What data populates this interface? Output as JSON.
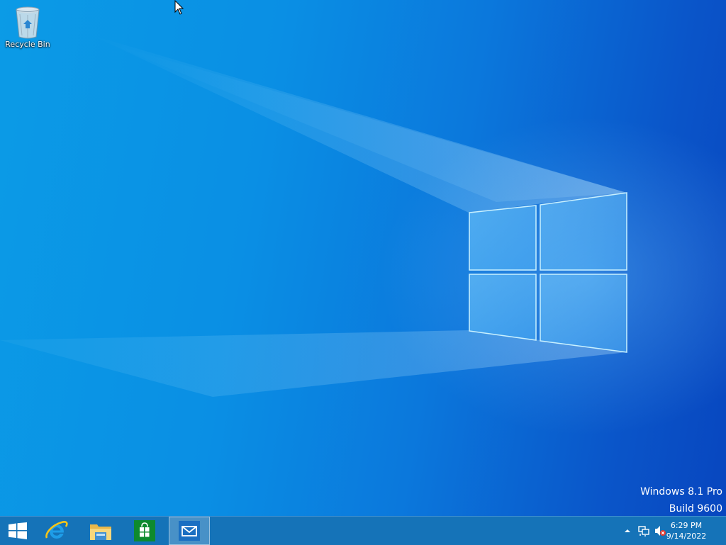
{
  "desktop": {
    "icons": [
      {
        "label": "Recycle Bin",
        "icon": "recycle-bin-icon"
      }
    ],
    "watermark": {
      "line1": "Windows 8.1 Pro",
      "line2": "Build 9600"
    }
  },
  "taskbar": {
    "start": {
      "icon": "windows-logo-icon"
    },
    "pinned": [
      {
        "name": "Internet Explorer",
        "icon": "internet-explorer-icon",
        "active": false
      },
      {
        "name": "File Explorer",
        "icon": "file-explorer-icon",
        "active": false
      },
      {
        "name": "Store",
        "icon": "store-icon",
        "active": false
      },
      {
        "name": "Mail",
        "icon": "mail-icon",
        "active": true
      }
    ],
    "tray": {
      "icons": [
        "show-hidden-icons-arrow-icon",
        "network-icon",
        "volume-muted-icon"
      ],
      "time": "6:29 PM",
      "date": "9/14/2022"
    }
  },
  "colors": {
    "taskbar": "#1573b8",
    "desktop_accent": "#0a8fe4",
    "store_green": "#0e8a2e",
    "mail_blue": "#1a6fc2"
  }
}
